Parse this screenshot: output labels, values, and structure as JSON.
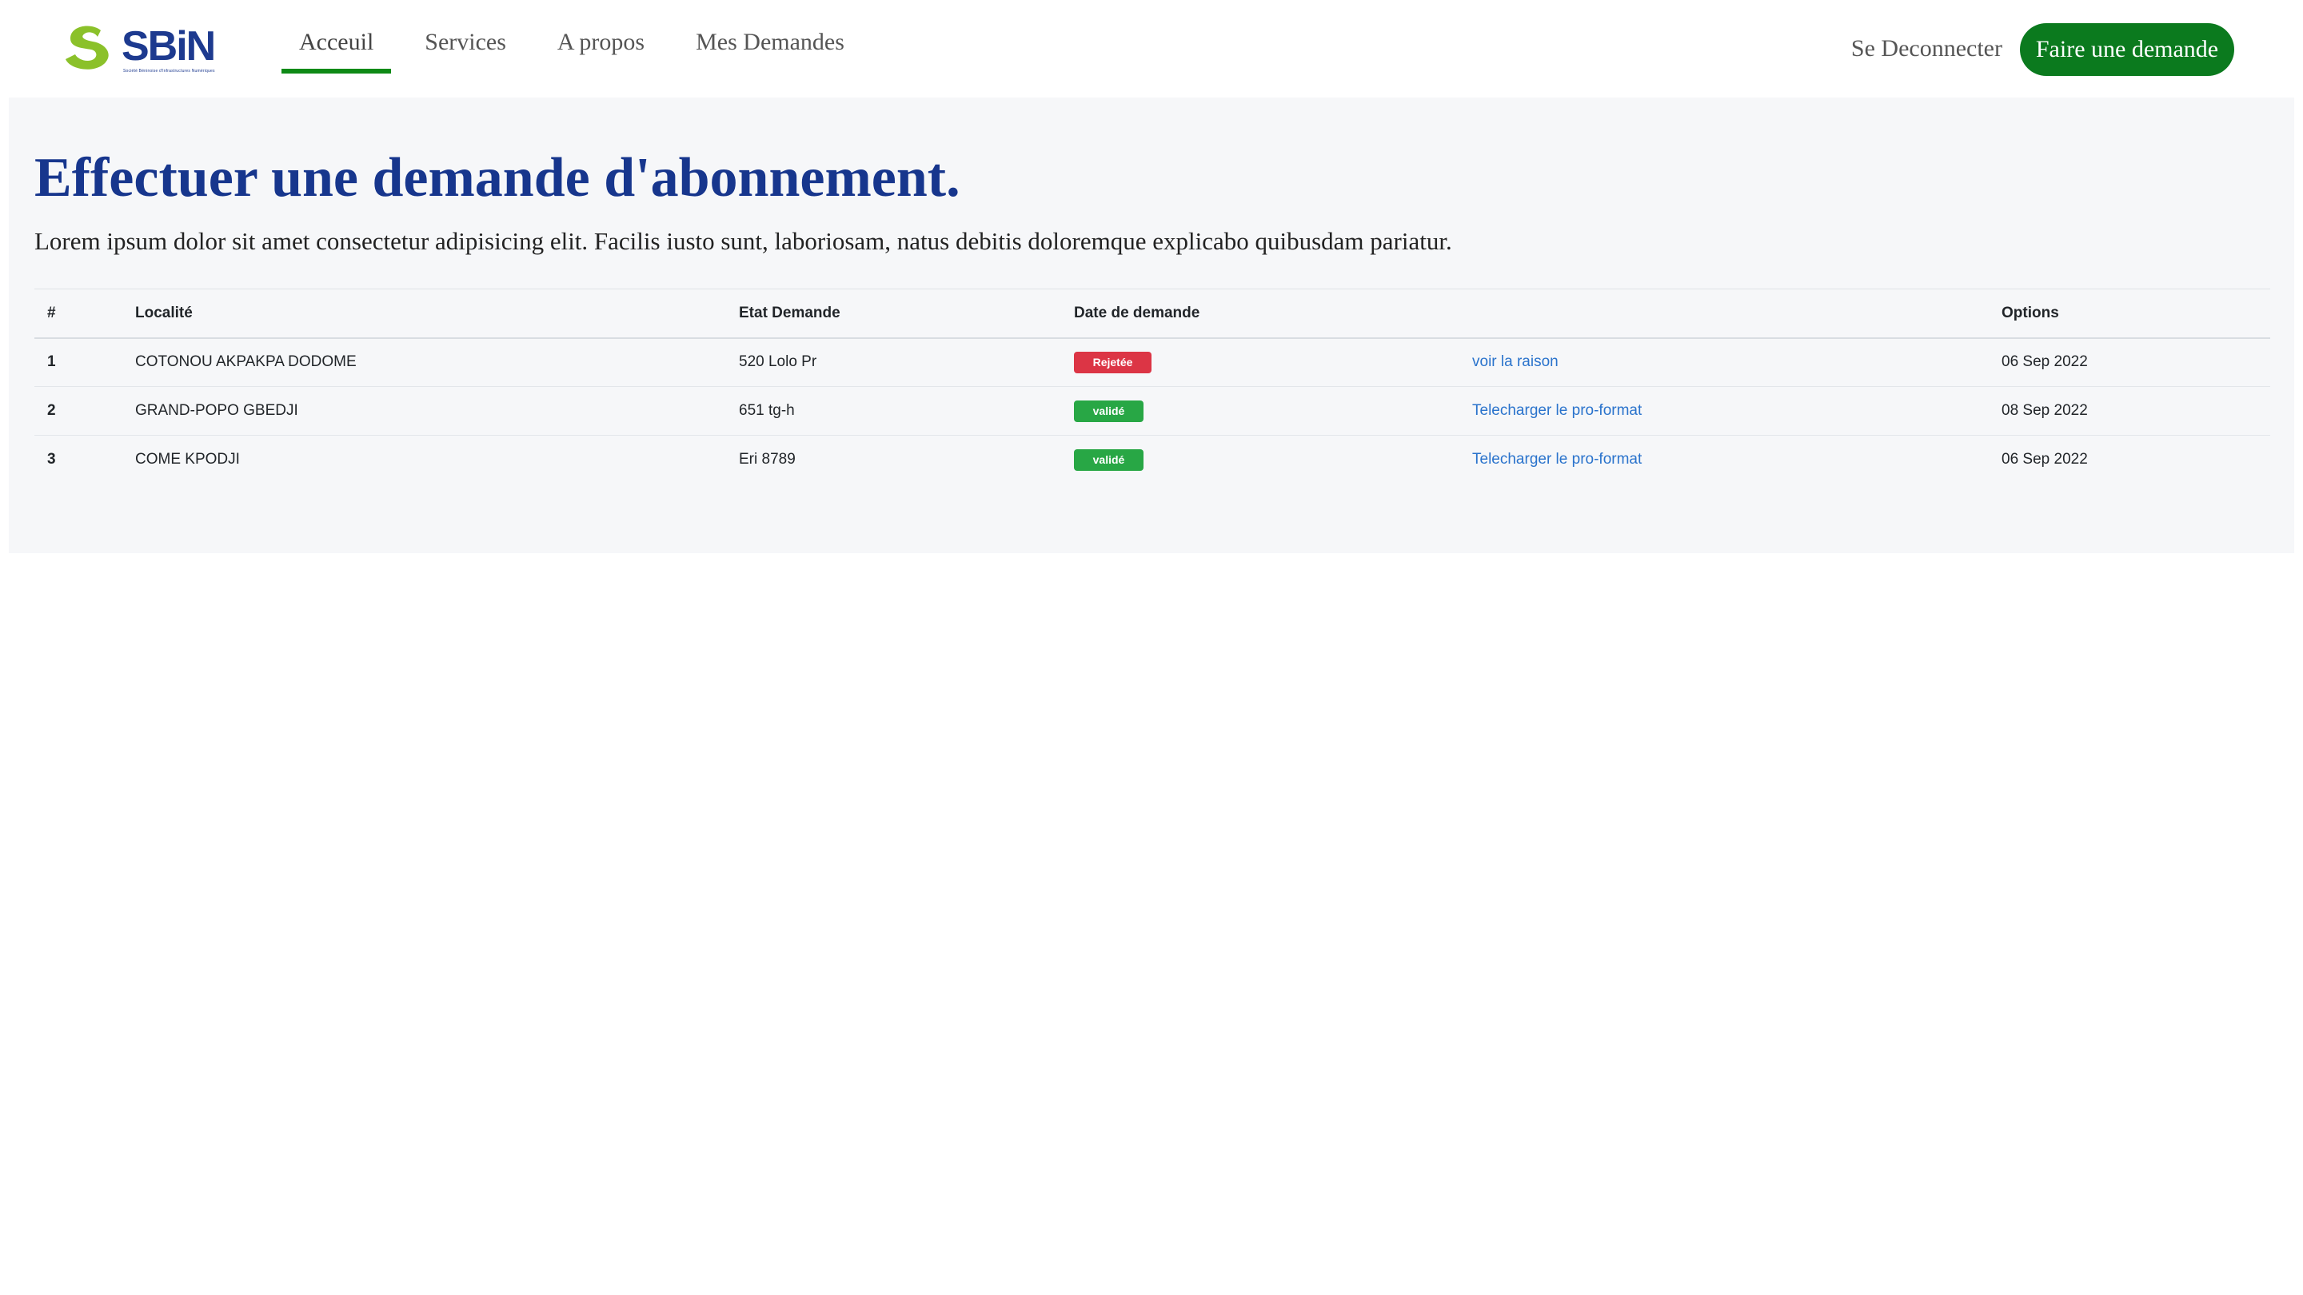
{
  "brand": {
    "name": "SBiN",
    "tagline": "Société Béninoise d'Infrastructures Numériques",
    "colors": {
      "green": "#8bc12a",
      "blue": "#1d3a8f"
    }
  },
  "nav": {
    "links": [
      {
        "label": "Acceuil",
        "active": true
      },
      {
        "label": "Services",
        "active": false
      },
      {
        "label": "A propos",
        "active": false
      },
      {
        "label": "Mes Demandes",
        "active": false
      }
    ],
    "logout_label": "Se Deconnecter",
    "cta_label": "Faire une demande",
    "accent_color": "#0e8a16"
  },
  "main": {
    "title": "Effectuer une demande d'abonnement.",
    "subtitle": "Lorem ipsum dolor sit amet consectetur adipisicing elit. Facilis iusto sunt, laboriosam, natus debitis doloremque explicabo quibusdam pariatur.",
    "table": {
      "headers": [
        "#",
        "Localité",
        "Etat Demande",
        "Date de demande",
        "",
        "Options"
      ],
      "rows": [
        {
          "num": "1",
          "locality": "COTONOU AKPAKPA DODOME",
          "state": "520 Lolo Pr",
          "badge": "Rejetée",
          "badge_type": "rejected",
          "action": "voir la raison",
          "date": "06 Sep 2022"
        },
        {
          "num": "2",
          "locality": "GRAND-POPO GBEDJI",
          "state": "651 tg-h",
          "badge": "validé",
          "badge_type": "valid",
          "action": "Telecharger le pro-format",
          "date": "08 Sep 2022"
        },
        {
          "num": "3",
          "locality": "COME KPODJI",
          "state": "Eri 8789",
          "badge": "validé",
          "badge_type": "valid",
          "action": "Telecharger le pro-format",
          "date": "06 Sep 2022"
        }
      ]
    }
  }
}
